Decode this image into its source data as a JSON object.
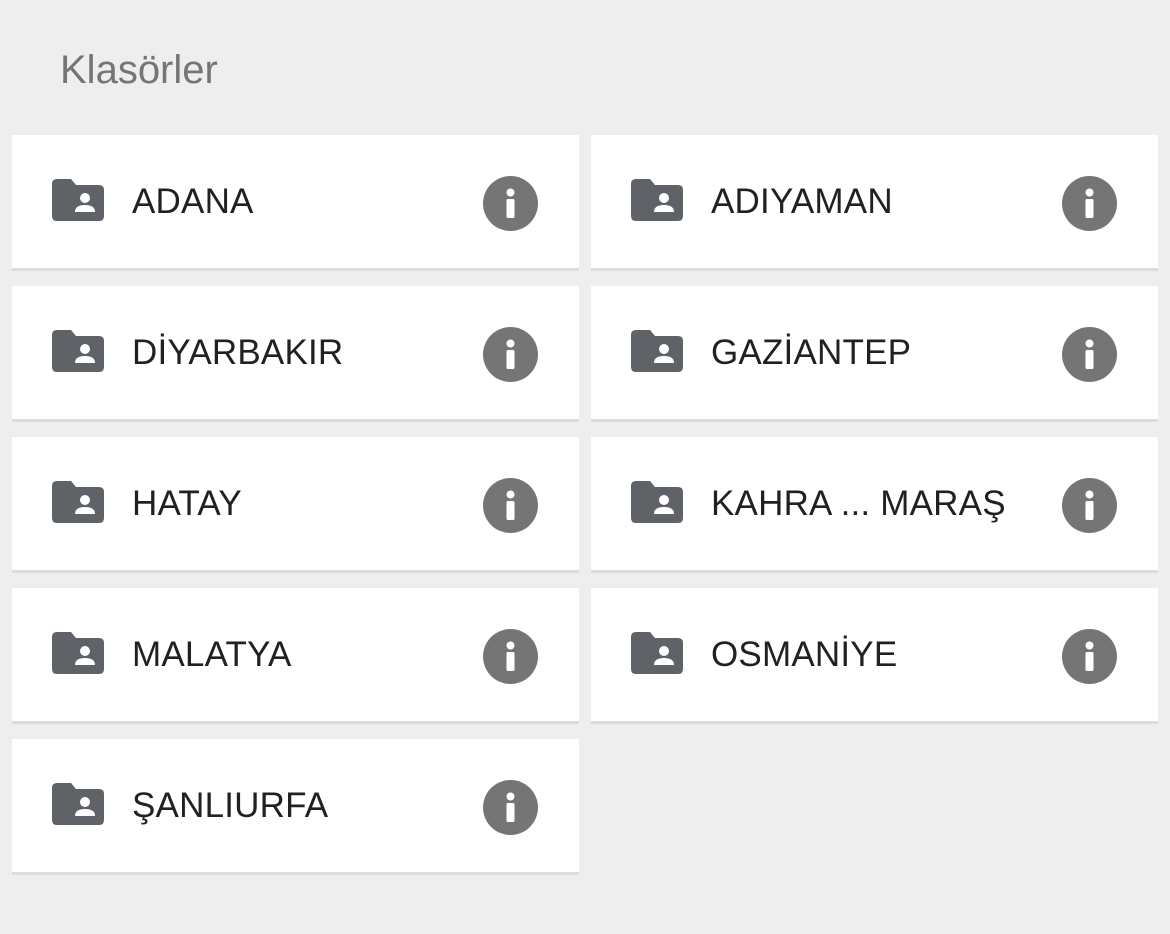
{
  "header": {
    "title": "Klasörler"
  },
  "folders": [
    {
      "name": "ADANA"
    },
    {
      "name": "ADIYAMAN"
    },
    {
      "name": "DİYARBAKIR"
    },
    {
      "name": "GAZİANTEP"
    },
    {
      "name": "HATAY"
    },
    {
      "name": "KAHRA ... MARAŞ"
    },
    {
      "name": "MALATYA"
    },
    {
      "name": "OSMANİYE"
    },
    {
      "name": "ŞANLIURFA"
    }
  ],
  "icons": {
    "folder": "folder-shared-icon",
    "info": "info-icon"
  },
  "colors": {
    "background": "#eeeeee",
    "card": "#ffffff",
    "icon": "#5f6368",
    "info": "#757575",
    "text": "#202124",
    "title": "#757575"
  }
}
